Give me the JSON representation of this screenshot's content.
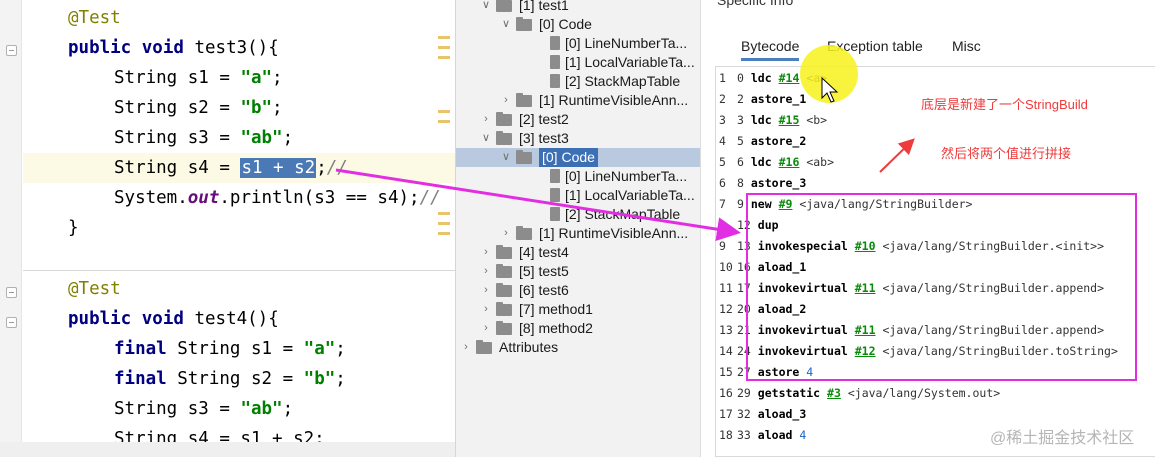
{
  "editor": {
    "lines": [
      {
        "annotation": "@Test"
      },
      {
        "kw1": "public",
        "kw2": "void",
        "rest": " test3(){"
      },
      {
        "type": "String",
        "rest": " s1 = ",
        "str": "\"a\"",
        "end": ";"
      },
      {
        "type": "String",
        "rest": " s2 = ",
        "str": "\"b\"",
        "end": ";"
      },
      {
        "type": "String",
        "rest": " s3 = ",
        "str": "\"ab\"",
        "end": ";"
      },
      {
        "type": "String",
        "rest": " s4 = ",
        "sel": "s1 + s2",
        "end": ";",
        "cmt": "//"
      },
      {
        "pre": "System.",
        "ital": "out",
        "mid": ".println(s3 == s4);",
        "cmt": "//"
      },
      {
        "brace": "}"
      },
      {
        "annotation": "@Test"
      },
      {
        "kw1": "public",
        "kw2": "void",
        "rest": " test4(){"
      },
      {
        "kw": "final",
        "type": " String",
        "rest": " s1 = ",
        "str": "\"a\"",
        "end": ";"
      },
      {
        "kw": "final",
        "type": " String",
        "rest": " s2 = ",
        "str": "\"b\"",
        "end": ";"
      },
      {
        "type": "String",
        "rest": " s3 = ",
        "str": "\"ab\"",
        "end": ";"
      },
      {
        "type": "String",
        "rest": " s4 = s1 + s2;"
      }
    ]
  },
  "tree": {
    "rows": [
      {
        "label": "[1] test1",
        "kind": "folder",
        "expanded": true,
        "level": 1
      },
      {
        "label": "[0] Code",
        "kind": "folder",
        "expanded": true,
        "level": 2
      },
      {
        "label": "[0] LineNumberTa...",
        "kind": "file",
        "level": 3
      },
      {
        "label": "[1] LocalVariableTa...",
        "kind": "file",
        "level": 3
      },
      {
        "label": "[2] StackMapTable",
        "kind": "file",
        "level": 3
      },
      {
        "label": "[1] RuntimeVisibleAnn...",
        "kind": "folder",
        "expanded": false,
        "level": 2
      },
      {
        "label": "[2] test2",
        "kind": "folder",
        "expanded": false,
        "level": 1
      },
      {
        "label": "[3] test3",
        "kind": "folder",
        "expanded": true,
        "level": 1
      },
      {
        "label": "[0] Code",
        "kind": "folder",
        "expanded": true,
        "level": 2,
        "selected": true
      },
      {
        "label": "[0] LineNumberTa...",
        "kind": "file",
        "level": 3
      },
      {
        "label": "[1] LocalVariableTa...",
        "kind": "file",
        "level": 3
      },
      {
        "label": "[2] StackMapTable",
        "kind": "file",
        "level": 3
      },
      {
        "label": "[1] RuntimeVisibleAnn...",
        "kind": "folder",
        "expanded": false,
        "level": 2
      },
      {
        "label": "[4] test4",
        "kind": "folder",
        "expanded": false,
        "level": 1
      },
      {
        "label": "[5] test5",
        "kind": "folder",
        "expanded": false,
        "level": 1
      },
      {
        "label": "[6] test6",
        "kind": "folder",
        "expanded": false,
        "level": 1
      },
      {
        "label": "[7] method1",
        "kind": "folder",
        "expanded": false,
        "level": 1
      },
      {
        "label": "[8] method2",
        "kind": "folder",
        "expanded": false,
        "level": 1
      },
      {
        "label": "Attributes",
        "kind": "folder",
        "expanded": false,
        "level": 0
      }
    ]
  },
  "info": {
    "title": "Specific Info",
    "tabs": [
      "Bytecode",
      "Exception table",
      "Misc"
    ],
    "active_tab": 0,
    "bytecode": [
      {
        "line": "1",
        "offset": "0",
        "op": "ldc",
        "ref": "#14",
        "arg": "<a>"
      },
      {
        "line": "2",
        "offset": "2",
        "op": "astore_1",
        "ref": "",
        "arg": ""
      },
      {
        "line": "3",
        "offset": "3",
        "op": "ldc",
        "ref": "#15",
        "arg": "<b>"
      },
      {
        "line": "4",
        "offset": "5",
        "op": "astore_2",
        "ref": "",
        "arg": ""
      },
      {
        "line": "5",
        "offset": "6",
        "op": "ldc",
        "ref": "#16",
        "arg": "<ab>"
      },
      {
        "line": "6",
        "offset": "8",
        "op": "astore_3",
        "ref": "",
        "arg": ""
      },
      {
        "line": "7",
        "offset": "9",
        "op": "new",
        "ref": "#9",
        "arg": "<java/lang/StringBuilder>"
      },
      {
        "line": "8",
        "offset": "12",
        "op": "dup",
        "ref": "",
        "arg": ""
      },
      {
        "line": "9",
        "offset": "13",
        "op": "invokespecial",
        "ref": "#10",
        "arg": "<java/lang/StringBuilder.<init>>"
      },
      {
        "line": "10",
        "offset": "16",
        "op": "aload_1",
        "ref": "",
        "arg": ""
      },
      {
        "line": "11",
        "offset": "17",
        "op": "invokevirtual",
        "ref": "#11",
        "arg": "<java/lang/StringBuilder.append>"
      },
      {
        "line": "12",
        "offset": "20",
        "op": "aload_2",
        "ref": "",
        "arg": ""
      },
      {
        "line": "13",
        "offset": "21",
        "op": "invokevirtual",
        "ref": "#11",
        "arg": "<java/lang/StringBuilder.append>"
      },
      {
        "line": "14",
        "offset": "24",
        "op": "invokevirtual",
        "ref": "#12",
        "arg": "<java/lang/StringBuilder.toString>"
      },
      {
        "line": "15",
        "offset": "27",
        "op": "astore",
        "ref": "",
        "arg": "4"
      },
      {
        "line": "16",
        "offset": "29",
        "op": "getstatic",
        "ref": "#3",
        "arg": "<java/lang/System.out>"
      },
      {
        "line": "17",
        "offset": "32",
        "op": "aload_3",
        "ref": "",
        "arg": ""
      },
      {
        "line": "18",
        "offset": "33",
        "op": "aload",
        "ref": "",
        "arg": "4"
      }
    ]
  },
  "annotations": {
    "note1": "底层是新建了一个StringBuild",
    "note2": "然后将两个值进行拼接"
  },
  "watermark": "@稀土掘金技术社区",
  "colors": {
    "highlight_box": "#e22ee2",
    "arrow": "#e22ee2",
    "note": "#ee3b3b",
    "cursor": "#f7f21b"
  }
}
